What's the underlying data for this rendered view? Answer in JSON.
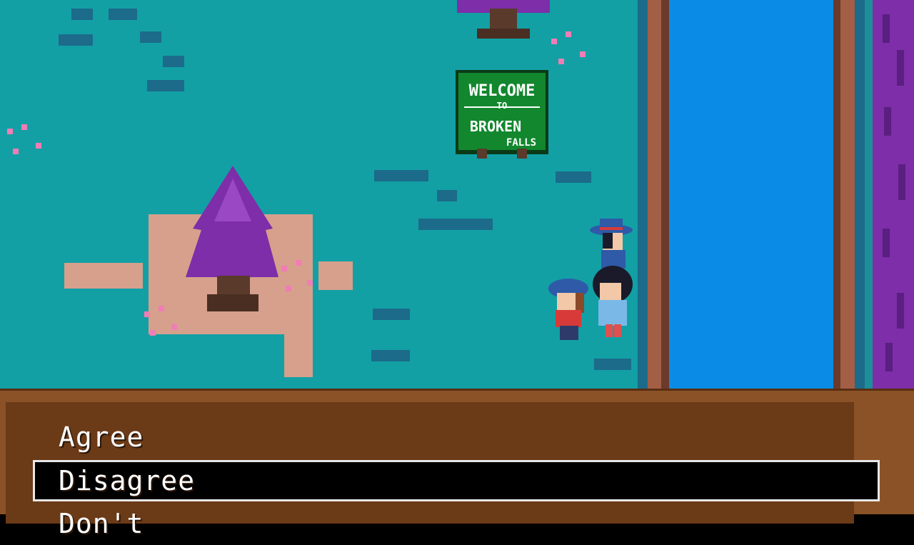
{
  "scene": {
    "sign": {
      "line1": "WELCOME",
      "line2": "TO",
      "line3": "BROKEN",
      "line4": "FALLS"
    },
    "colors": {
      "grass": "#12a0a5",
      "grass_tuft": "#1c6b8a",
      "river": "#0a8ce6",
      "cliff": "#a35e46",
      "tree_purple": "#7d2ea8",
      "dirt_patch": "#d6a08c",
      "sign_green": "#12872e",
      "flower_pink": "#f07db4"
    }
  },
  "choices": {
    "items": [
      {
        "label": "Agree",
        "selected": false
      },
      {
        "label": "Disagree",
        "selected": true
      },
      {
        "label": "Don't",
        "selected": false
      }
    ]
  }
}
